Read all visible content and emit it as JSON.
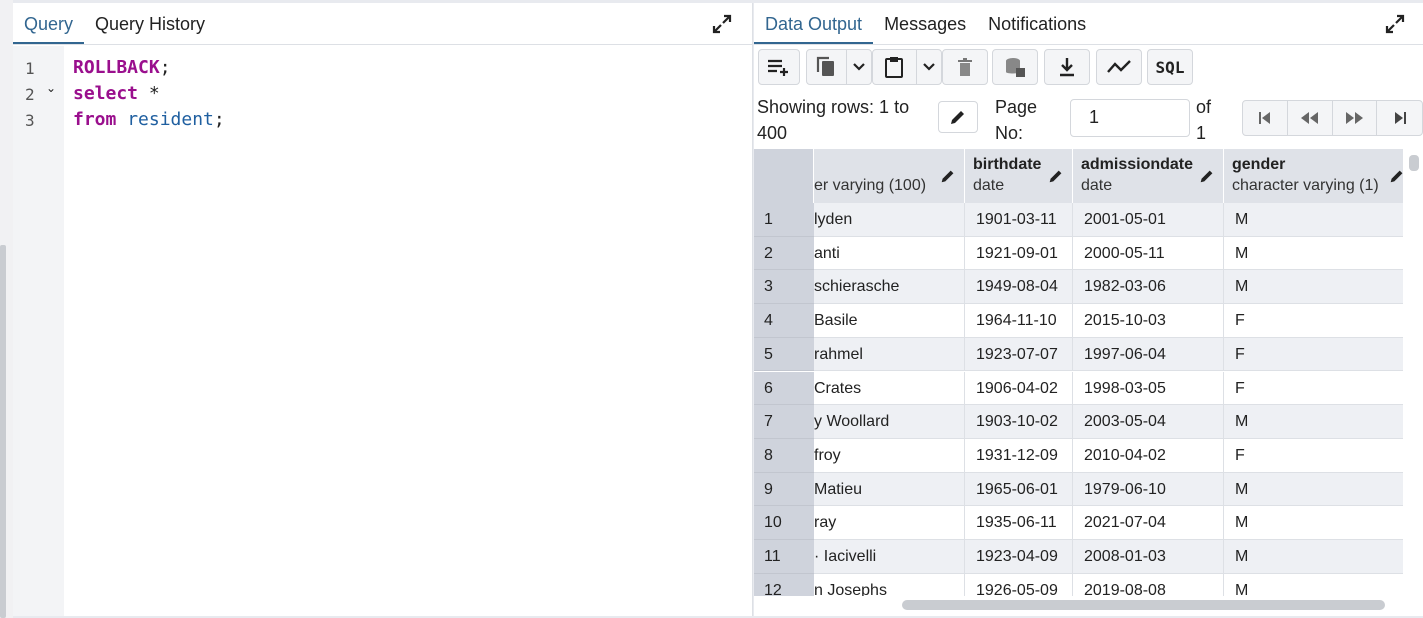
{
  "query_panel": {
    "tabs": [
      {
        "label": "Query",
        "active": true
      },
      {
        "label": "Query History",
        "active": false
      }
    ],
    "lines": [
      {
        "num": "1",
        "tokens": [
          {
            "t": "ROLLBACK",
            "c": "kw"
          },
          {
            "t": ";",
            "c": "pl"
          }
        ]
      },
      {
        "num": "2",
        "fold": "⌄",
        "tokens": [
          {
            "t": "select",
            "c": "kw"
          },
          {
            "t": " *",
            "c": "pl"
          }
        ]
      },
      {
        "num": "3",
        "tokens": [
          {
            "t": "from",
            "c": "kw"
          },
          {
            "t": " ",
            "c": "pl"
          },
          {
            "t": "resident",
            "c": "id"
          },
          {
            "t": ";",
            "c": "pl"
          }
        ]
      }
    ]
  },
  "data_panel": {
    "tabs": [
      {
        "label": "Data Output",
        "active": true
      },
      {
        "label": "Messages",
        "active": false
      },
      {
        "label": "Notifications",
        "active": false
      }
    ],
    "pager": {
      "showing_line1": "Showing rows: 1 to",
      "showing_line2": "400",
      "page_line1": "Page",
      "page_line2": "No:",
      "page_value": "1",
      "of_line1": "of",
      "of_line2": "1"
    },
    "columns": [
      {
        "name": "",
        "type": "er varying (100)"
      },
      {
        "name": "birthdate",
        "type": "date"
      },
      {
        "name": "admissiondate",
        "type": "date"
      },
      {
        "name": "gender",
        "type": "character varying (1)"
      }
    ],
    "rows": [
      {
        "n": "1",
        "c": [
          "lyden",
          "1901-03-11",
          "2001-05-01",
          "M"
        ]
      },
      {
        "n": "2",
        "c": [
          "anti",
          "1921-09-01",
          "2000-05-11",
          "M"
        ]
      },
      {
        "n": "3",
        "c": [
          "schierasche",
          "1949-08-04",
          "1982-03-06",
          "M"
        ]
      },
      {
        "n": "4",
        "c": [
          " Basile",
          "1964-11-10",
          "2015-10-03",
          "F"
        ]
      },
      {
        "n": "5",
        "c": [
          "rahmel",
          "1923-07-07",
          "1997-06-04",
          "F"
        ]
      },
      {
        "n": "6",
        "c": [
          " Crates",
          "1906-04-02",
          "1998-03-05",
          "F"
        ]
      },
      {
        "n": "7",
        "c": [
          "y Woollard",
          "1903-10-02",
          "2003-05-04",
          "M"
        ]
      },
      {
        "n": "8",
        "c": [
          " froy",
          "1931-12-09",
          "2010-04-02",
          "F"
        ]
      },
      {
        "n": "9",
        "c": [
          " Matieu",
          "1965-06-01",
          "1979-06-10",
          "M"
        ]
      },
      {
        "n": "10",
        "c": [
          "ray",
          "1935-06-11",
          "2021-07-04",
          "M"
        ]
      },
      {
        "n": "11",
        "c": [
          "· Iacivelli",
          "1923-04-09",
          "2008-01-03",
          "M"
        ]
      },
      {
        "n": "12",
        "c": [
          "n Josephs",
          "1926-05-09",
          "2019-08-08",
          "M"
        ]
      }
    ],
    "toolbar": {
      "sql_label": "SQL"
    }
  }
}
